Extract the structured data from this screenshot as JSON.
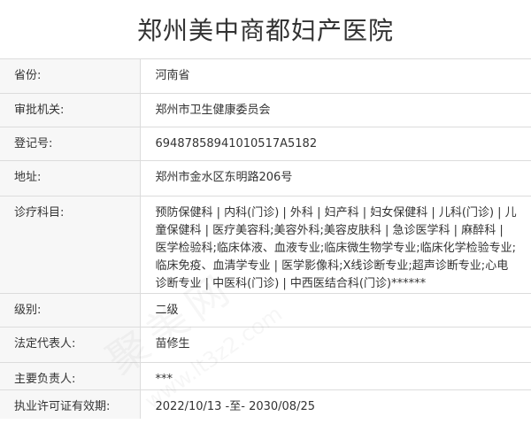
{
  "title": "郑州美中商都妇产医院",
  "rows": [
    {
      "label": "省份:",
      "value": "河南省"
    },
    {
      "label": "审批机关:",
      "value": "郑州市卫生健康委员会"
    },
    {
      "label": "登记号:",
      "value": "69487858941010517A5182"
    },
    {
      "label": "地址:",
      "value": "郑州市金水区东明路206号"
    },
    {
      "label": "诊疗科目:",
      "value": "预防保健科 | 内科(门诊) | 外科 | 妇产科 | 妇女保健科 | 儿科(门诊) | 儿童保健科 | 医疗美容科;美容外科;美容皮肤科 | 急诊医学科 | 麻醉科 | 医学检验科;临床体液、血液专业;临床微生物学专业;临床化学检验专业;临床免疫、血清学专业 | 医学影像科;X线诊断专业;超声诊断专业;心电诊断专业 | 中医科(门诊) | 中西医结合科(门诊)******"
    },
    {
      "label": "级别:",
      "value": "二级"
    },
    {
      "label": "法定代表人:",
      "value": "苗修生"
    },
    {
      "label": "主要负责人:",
      "value": "***"
    },
    {
      "label": "执业许可证有效期:",
      "value": "2022/10/13 -至- 2030/08/25"
    }
  ],
  "watermark": {
    "text": "聚美网",
    "url": "www.lt3z2.com"
  }
}
